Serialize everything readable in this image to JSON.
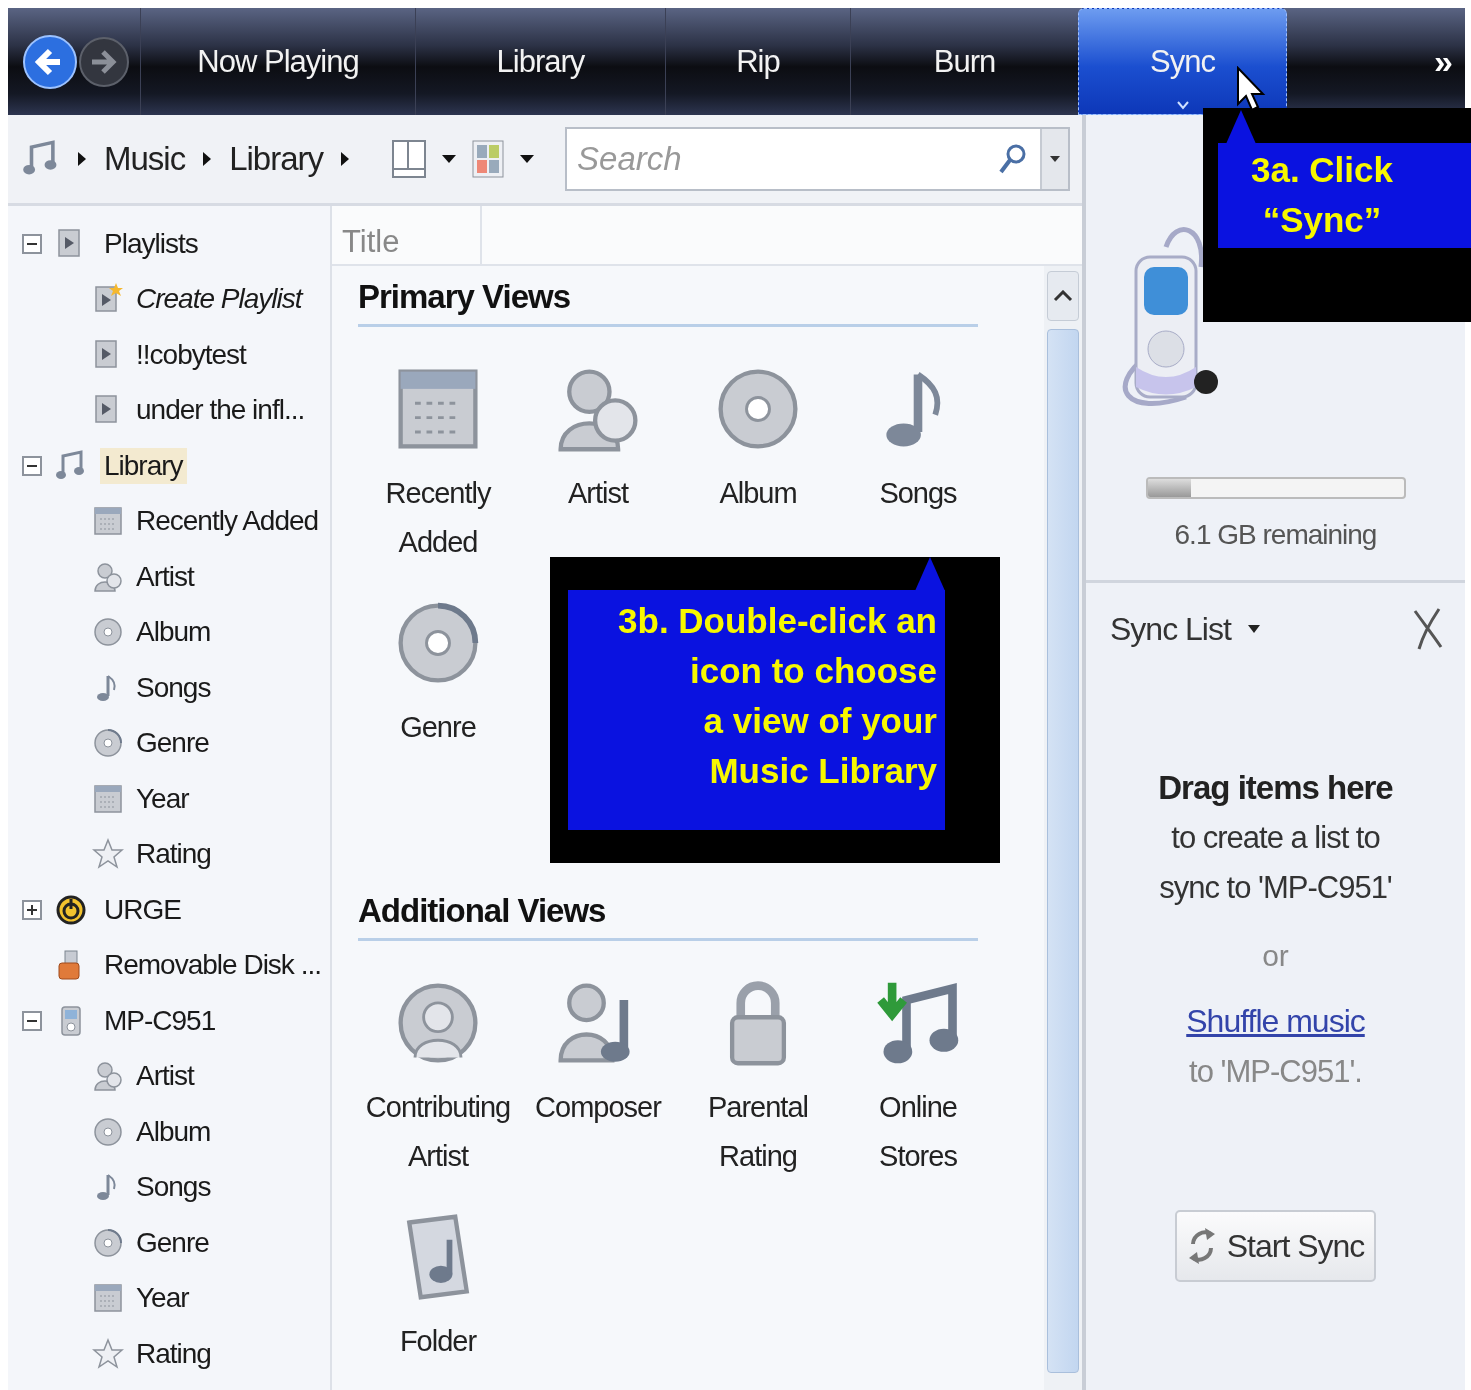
{
  "nav": {
    "tabs": [
      {
        "label": "Now Playing",
        "selected": false
      },
      {
        "label": "Library",
        "selected": false
      },
      {
        "label": "Rip",
        "selected": false
      },
      {
        "label": "Burn",
        "selected": false
      },
      {
        "label": "Sync",
        "selected": true
      }
    ],
    "more": "»"
  },
  "toolbar": {
    "breadcrumb": [
      "Music",
      "Library"
    ],
    "search": {
      "placeholder": "Search"
    }
  },
  "sidebar": {
    "items": [
      {
        "label": "Playlists",
        "kind": "playlist",
        "expanded": true,
        "selected": false,
        "children": [
          {
            "label": "Create Playlist",
            "kind": "new_playlist",
            "selected": false
          },
          {
            "label": "!!cobytest",
            "kind": "playlist",
            "selected": false
          },
          {
            "label": "under the infl...",
            "kind": "playlist",
            "selected": false
          }
        ]
      },
      {
        "label": "Library",
        "kind": "library",
        "expanded": true,
        "selected": true,
        "children": [
          {
            "label": "Recently Added",
            "kind": "calendar",
            "selected": false
          },
          {
            "label": "Artist",
            "kind": "artist",
            "selected": false
          },
          {
            "label": "Album",
            "kind": "album",
            "selected": false
          },
          {
            "label": "Songs",
            "kind": "song",
            "selected": false
          },
          {
            "label": "Genre",
            "kind": "genre",
            "selected": false
          },
          {
            "label": "Year",
            "kind": "calendar",
            "selected": false
          },
          {
            "label": "Rating",
            "kind": "rating",
            "selected": false
          }
        ]
      },
      {
        "label": "URGE",
        "kind": "urge",
        "expanded": false,
        "selected": false
      },
      {
        "label": "Removable Disk ...",
        "kind": "disk",
        "selected": false
      },
      {
        "label": "MP-C951",
        "kind": "device",
        "expanded": true,
        "selected": false,
        "children": [
          {
            "label": "Artist",
            "kind": "artist",
            "selected": false
          },
          {
            "label": "Album",
            "kind": "album",
            "selected": false
          },
          {
            "label": "Songs",
            "kind": "song",
            "selected": false
          },
          {
            "label": "Genre",
            "kind": "genre",
            "selected": false
          },
          {
            "label": "Year",
            "kind": "calendar",
            "selected": false
          },
          {
            "label": "Rating",
            "kind": "rating",
            "selected": false
          }
        ]
      }
    ]
  },
  "content": {
    "columns": [
      "Title"
    ],
    "sections": [
      {
        "title": "Primary Views",
        "items": [
          {
            "label": "Recently\nAdded",
            "kind": "calendar"
          },
          {
            "label": "Artist",
            "kind": "artist"
          },
          {
            "label": "Album",
            "kind": "album"
          },
          {
            "label": "Songs",
            "kind": "song"
          },
          {
            "label": "Genre",
            "kind": "genre"
          }
        ]
      },
      {
        "title": "Additional Views",
        "items": [
          {
            "label": "Contributing\nArtist",
            "kind": "contributing"
          },
          {
            "label": "Composer",
            "kind": "composer"
          },
          {
            "label": "Parental\nRating",
            "kind": "parental"
          },
          {
            "label": "Online\nStores",
            "kind": "stores"
          },
          {
            "label": "Folder",
            "kind": "folder"
          }
        ]
      }
    ]
  },
  "device_panel": {
    "storage": {
      "level": 0.17
    },
    "remaining": "6.1 GB remaining"
  },
  "sync_list": {
    "title": "Sync List",
    "heading": "Drag items here",
    "message": "to create a list to sync to 'MP-C951'",
    "or": "or",
    "link": "Shuffle music",
    "link_suffix": "to 'MP-C951'.",
    "button": "Start Sync"
  },
  "callouts": [
    {
      "text": "3a. Click\n“Sync”"
    },
    {
      "text": "3b.  Double-click an\nicon  to  choose\na view of your\nMusic   Library"
    }
  ]
}
